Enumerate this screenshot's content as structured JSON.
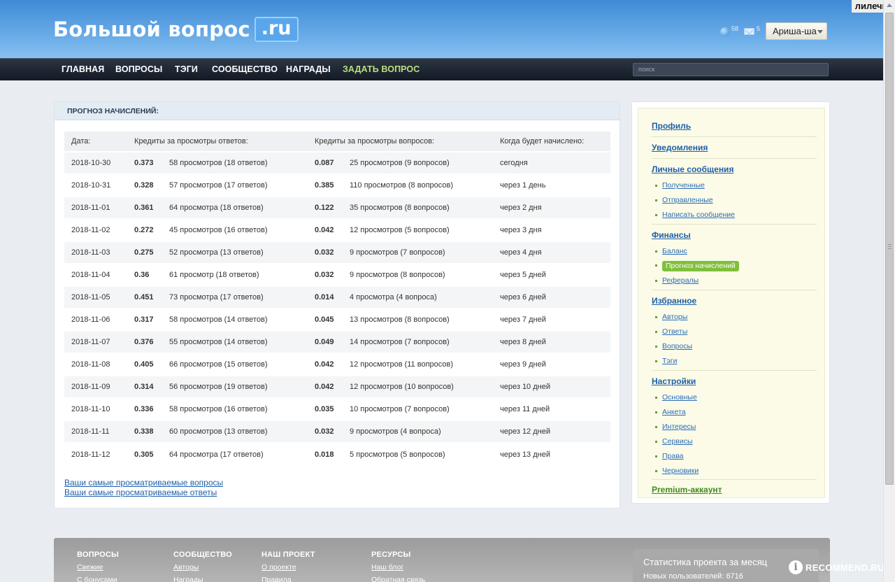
{
  "header": {
    "logo_main": "Большой вопрос",
    "logo_suffix": ".ru",
    "login_tag": "лилечка",
    "points": "58",
    "messages": "5",
    "user": "Ариша-ша"
  },
  "nav": {
    "items": [
      "ГЛАВНАЯ",
      "ВОПРОСЫ",
      "ТЭГИ",
      "СООБЩЕСТВО",
      "НАГРАДЫ",
      "ЗАДАТЬ ВОПРОС"
    ],
    "search_placeholder": "поиск"
  },
  "panel": {
    "title": "ПРОГНОЗ НАЧИСЛЕНИЙ:",
    "columns": [
      "Дата:",
      "Кредиты за просмотры ответов:",
      "Кредиты за просмотры вопросов:",
      "Когда будет начислено:"
    ],
    "rows": [
      {
        "date": "2018-10-30",
        "aval": "0.373",
        "atext": "58 просмотров (18 ответов)",
        "qval": "0.087",
        "qtext": "25 просмотров (9 вопросов)",
        "when": "сегодня"
      },
      {
        "date": "2018-10-31",
        "aval": "0.328",
        "atext": "57 просмотров (17 ответов)",
        "qval": "0.385",
        "qtext": "110 просмотров (8 вопросов)",
        "when": "через 1 день"
      },
      {
        "date": "2018-11-01",
        "aval": "0.361",
        "atext": "64 просмотра (18 ответов)",
        "qval": "0.122",
        "qtext": "35 просмотров (8 вопросов)",
        "when": "через 2 дня"
      },
      {
        "date": "2018-11-02",
        "aval": "0.272",
        "atext": "45 просмотров (16 ответов)",
        "qval": "0.042",
        "qtext": "12 просмотров (5 вопросов)",
        "when": "через 3 дня"
      },
      {
        "date": "2018-11-03",
        "aval": "0.275",
        "atext": "52 просмотра (13 ответов)",
        "qval": "0.032",
        "qtext": "9 просмотров (7 вопросов)",
        "when": "через 4 дня"
      },
      {
        "date": "2018-11-04",
        "aval": "0.36",
        "atext": "61 просмотр (18 ответов)",
        "qval": "0.032",
        "qtext": "9 просмотров (8 вопросов)",
        "when": "через 5 дней"
      },
      {
        "date": "2018-11-05",
        "aval": "0.451",
        "atext": "73 просмотра (17 ответов)",
        "qval": "0.014",
        "qtext": "4 просмотра (4 вопроса)",
        "when": "через 6 дней"
      },
      {
        "date": "2018-11-06",
        "aval": "0.317",
        "atext": "58 просмотров (14 ответов)",
        "qval": "0.045",
        "qtext": "13 просмотров (8 вопросов)",
        "when": "через 7 дней"
      },
      {
        "date": "2018-11-07",
        "aval": "0.376",
        "atext": "55 просмотров (14 ответов)",
        "qval": "0.049",
        "qtext": "14 просмотров (7 вопросов)",
        "when": "через 8 дней"
      },
      {
        "date": "2018-11-08",
        "aval": "0.405",
        "atext": "66 просмотров (15 ответов)",
        "qval": "0.042",
        "qtext": "12 просмотров (11 вопросов)",
        "when": "через 9 дней"
      },
      {
        "date": "2018-11-09",
        "aval": "0.314",
        "atext": "56 просмотров (19 ответов)",
        "qval": "0.042",
        "qtext": "12 просмотров (10 вопросов)",
        "when": "через 10 дней"
      },
      {
        "date": "2018-11-10",
        "aval": "0.336",
        "atext": "58 просмотров (16 ответов)",
        "qval": "0.035",
        "qtext": "10 просмотров (7 вопросов)",
        "when": "через 11 дней"
      },
      {
        "date": "2018-11-11",
        "aval": "0.338",
        "atext": "60 просмотров (13 ответов)",
        "qval": "0.032",
        "qtext": "9 просмотров (4 вопроса)",
        "when": "через 12 дней"
      },
      {
        "date": "2018-11-12",
        "aval": "0.305",
        "atext": "64 просмотра (17 ответов)",
        "qval": "0.018",
        "qtext": "5 просмотров (5 вопросов)",
        "when": "через 13 дней"
      }
    ],
    "link_questions": "Ваши самые просматриваемые вопросы",
    "link_answers": "Ваши самые просматриваемые ответы"
  },
  "sidebar": {
    "profile": "Профиль",
    "notifications": "Уведомления",
    "messages": "Личные сообщения",
    "messages_sub": [
      "Полученные",
      "Отправленные",
      "Написать сообщение"
    ],
    "finance": "Финансы",
    "finance_sub": [
      "Баланс",
      "Прогноз начислений",
      "Рефералы"
    ],
    "favorites": "Избранное",
    "favorites_sub": [
      "Авторы",
      "Ответы",
      "Вопросы",
      "Тэги"
    ],
    "settings": "Настройки",
    "settings_sub": [
      "Основные",
      "Анкета",
      "Интересы",
      "Сервисы",
      "Права",
      "Черновики"
    ],
    "premium": "Premium-аккаунт"
  },
  "footer": {
    "col1_head": "ВОПРОСЫ",
    "col1_links": [
      "Свежие",
      "С бонусами"
    ],
    "col2_head": "СООБЩЕСТВО",
    "col2_links": [
      "Авторы",
      "Награды"
    ],
    "col3_head": "НАШ ПРОЕКТ",
    "col3_links": [
      "О проекте",
      "Правила"
    ],
    "col4_head": "РЕСУРСЫ",
    "col4_links": [
      "Наш блог",
      "Обратная связь"
    ],
    "stats_title": "Статистика проекта за месяц",
    "stats_line": "Новых пользователей: 6716",
    "watermark": "RECOMMEND.RU",
    "watermark_mark": "i"
  }
}
